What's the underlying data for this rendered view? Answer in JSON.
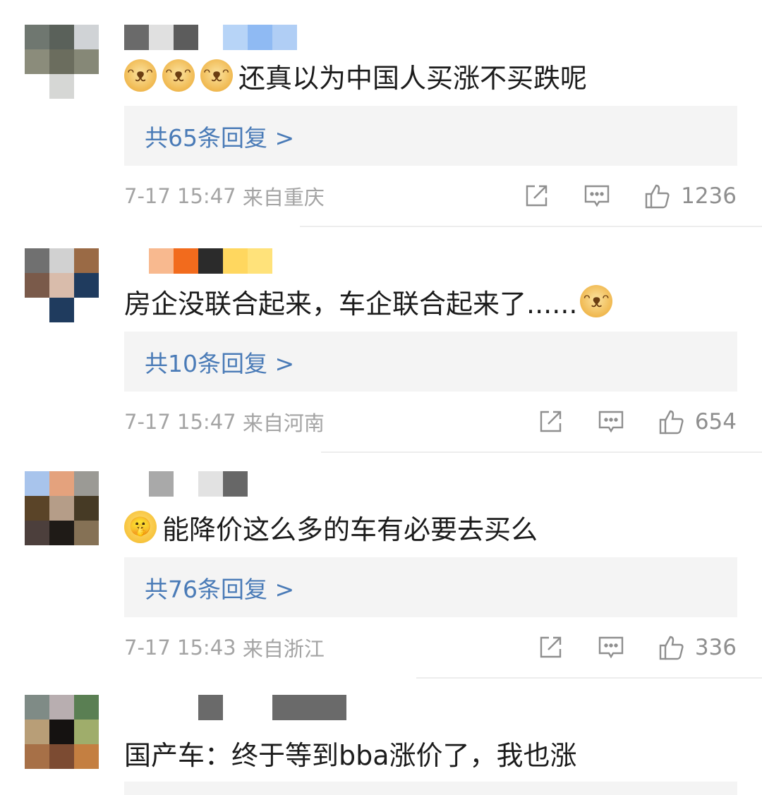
{
  "comments": [
    {
      "avatar_colors": [
        "#6f7770",
        "#5a615a",
        "#d0d3d6",
        "#8b8c7b",
        "#6b6d5e",
        "#868877",
        "#ffffff",
        "#d6d7d5",
        "#ffffff"
      ],
      "username_colors": [
        "#6a6a6a",
        "#e0e0e0",
        "#5c5c5c",
        "#ffffff",
        "#b7d4f7",
        "#8fbaf3",
        "#b0cef5"
      ],
      "emojis": [
        "doge-emoji",
        "doge-emoji",
        "doge-emoji"
      ],
      "text": "还真以为中国人买涨不买跌呢",
      "replies_label": "共65条回复 >",
      "time": "7-17 15:47",
      "location": "来自重庆",
      "likes": "1236"
    },
    {
      "avatar_colors": [
        "#707070",
        "#d1d1d1",
        "#9a6a45",
        "#7a5a4a",
        "#d9bcab",
        "#1f3b5e",
        "#ffffff",
        "#1f3b5e",
        "#ffffff"
      ],
      "username_colors": [
        "#f8b98f",
        "#f26b1d",
        "#2b2b2b",
        "#ffd75f",
        "#ffe27a"
      ],
      "emojis_after": [
        "doge-emoji"
      ],
      "text": "房企没联合起来，车企联合起来了......",
      "replies_label": "共10条回复 >",
      "time": "7-17 15:47",
      "location": "来自河南",
      "likes": "654"
    },
    {
      "avatar_colors": [
        "#a8c4ec",
        "#e4a27d",
        "#9b9a95",
        "#5a4428",
        "#b59d88",
        "#463a25",
        "#4c3f3c",
        "#1f1b17",
        "#857155"
      ],
      "username_colors": [
        "#ffffff",
        "#a9a9a9",
        "#ffffff",
        "#e2e2e2",
        "#676767"
      ],
      "emojis": [
        "shush-emoji"
      ],
      "text": "能降价这么多的车有必要去买么",
      "replies_label": "共76条回复 >",
      "time": "7-17 15:43",
      "location": "来自浙江",
      "likes": "336"
    },
    {
      "avatar_colors": [
        "#7f8b86",
        "#b8aeb0",
        "#5a7f53",
        "#b89e77",
        "#151211",
        "#9fad6b",
        "#a77047",
        "#7c4b32",
        "#c47f41"
      ],
      "username_colors": [
        "#ffffff",
        "#ffffff",
        "#ffffff",
        "#6a6a6a",
        "#ffffff",
        "#ffffff",
        "#6a6a6a",
        "#6a6a6a",
        "#6a6a6a"
      ],
      "text": "国产车：终于等到bba涨价了，我也涨"
    }
  ],
  "colors": {
    "link": "#4a7bb7",
    "meta": "#a4a4a4",
    "reply_bg": "#f4f4f4"
  }
}
